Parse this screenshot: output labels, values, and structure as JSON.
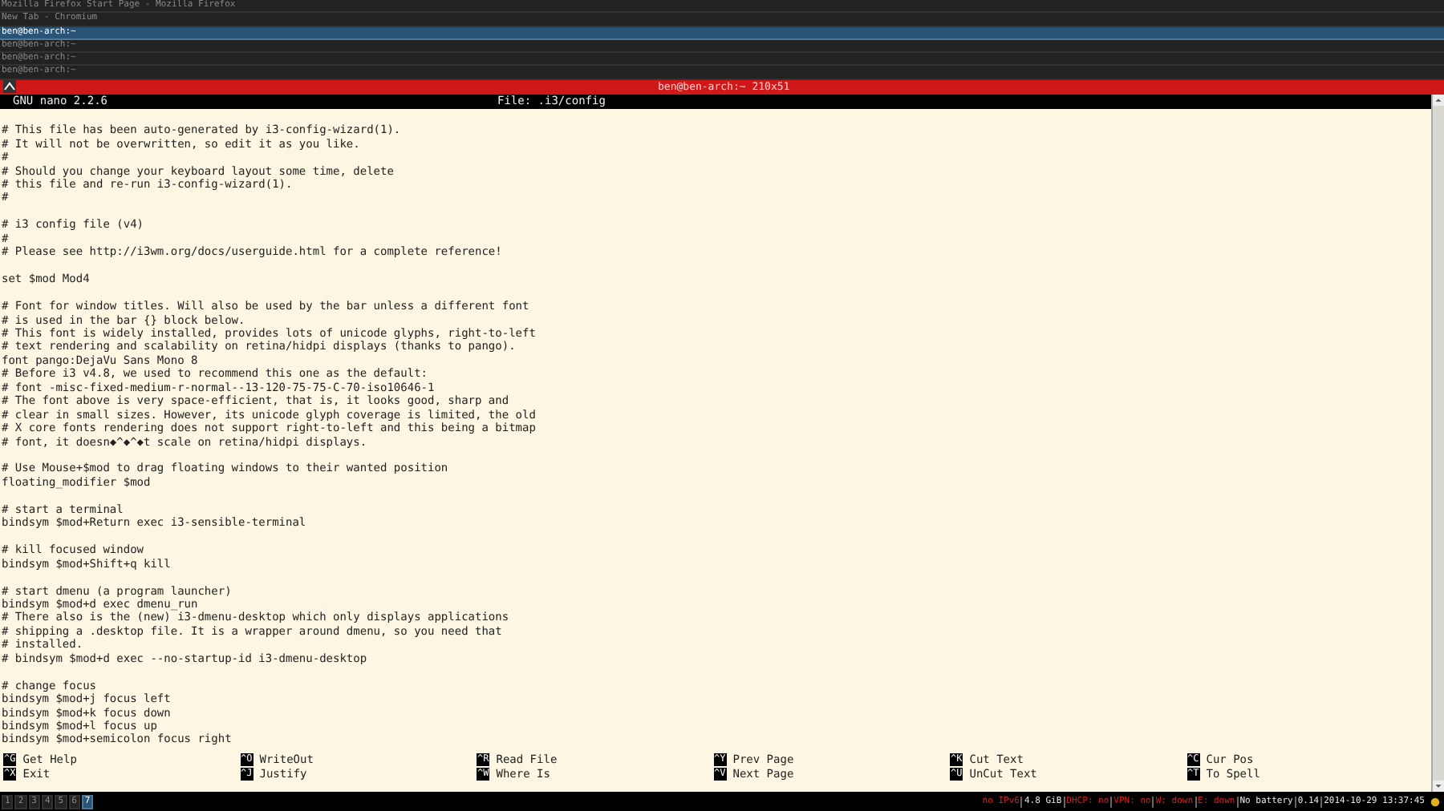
{
  "window_tabs": [
    {
      "title": "Mozilla Firefox Start Page - Mozilla Firefox",
      "selected": false
    },
    {
      "title": "New Tab - Chromium",
      "selected": false
    },
    {
      "title": "ben@ben-arch:~",
      "selected": true
    },
    {
      "title": "ben@ben-arch:~",
      "selected": false
    },
    {
      "title": "ben@ben-arch:~",
      "selected": false
    },
    {
      "title": "ben@ben-arch:~",
      "selected": false
    }
  ],
  "terminal": {
    "title": "ben@ben-arch:~ 210x51"
  },
  "nano": {
    "version": "GNU nano 2.2.6",
    "file": "File: .i3/config"
  },
  "lines": [
    {
      "kind": "blank"
    },
    {
      "kind": "text",
      "text": "# This file has been auto-generated by i3-config-wizard(1)."
    },
    {
      "kind": "text",
      "text": "# It will not be overwritten, so edit it as you like."
    },
    {
      "kind": "text",
      "text": "#"
    },
    {
      "kind": "text",
      "text": "# Should you change your keyboard layout some time, delete"
    },
    {
      "kind": "text",
      "text": "# this file and re-run i3-config-wizard(1)."
    },
    {
      "kind": "text",
      "text": "#"
    },
    {
      "kind": "blank"
    },
    {
      "kind": "text",
      "text": "# i3 config file (v4)"
    },
    {
      "kind": "text",
      "text": "#"
    },
    {
      "kind": "text",
      "text": "# Please see http://i3wm.org/docs/userguide.html for a complete reference!"
    },
    {
      "kind": "blank"
    },
    {
      "kind": "text",
      "text": "set $mod Mod4"
    },
    {
      "kind": "blank"
    },
    {
      "kind": "text",
      "text": "# Font for window titles. Will also be used by the bar unless a different font"
    },
    {
      "kind": "text",
      "text": "# is used in the bar {} block below."
    },
    {
      "kind": "text",
      "text": "# This font is widely installed, provides lots of unicode glyphs, right-to-left"
    },
    {
      "kind": "text",
      "text": "# text rendering and scalability on retina/hidpi displays (thanks to pango)."
    },
    {
      "kind": "text",
      "text": "font pango:DejaVu Sans Mono 8"
    },
    {
      "kind": "text",
      "text": "# Before i3 v4.8, we used to recommend this one as the default:"
    },
    {
      "kind": "text",
      "text": "# font -misc-fixed-medium-r-normal--13-120-75-75-C-70-iso10646-1"
    },
    {
      "kind": "text",
      "text": "# The font above is very space-efficient, that is, it looks good, sharp and"
    },
    {
      "kind": "text",
      "text": "# clear in small sizes. However, its unicode glyph coverage is limited, the old"
    },
    {
      "kind": "text",
      "text": "# X core fonts rendering does not support right-to-left and this being a bitmap"
    },
    {
      "kind": "text",
      "text": "# font, it doesn◆^◆^◆t scale on retina/hidpi displays."
    },
    {
      "kind": "blank"
    },
    {
      "kind": "text",
      "text": "# Use Mouse+$mod to drag floating windows to their wanted position"
    },
    {
      "kind": "text",
      "text": "floating_modifier $mod"
    },
    {
      "kind": "blank"
    },
    {
      "kind": "text",
      "text": "# start a terminal"
    },
    {
      "kind": "text",
      "text": "bindsym $mod+Return exec i3-sensible-terminal"
    },
    {
      "kind": "blank"
    },
    {
      "kind": "text",
      "text": "# kill focused window"
    },
    {
      "kind": "text",
      "text": "bindsym $mod+Shift+q kill"
    },
    {
      "kind": "blank"
    },
    {
      "kind": "text",
      "text": "# start dmenu (a program launcher)"
    },
    {
      "kind": "text",
      "text": "bindsym $mod+d exec dmenu_run"
    },
    {
      "kind": "text",
      "text": "# There also is the (new) i3-dmenu-desktop which only displays applications"
    },
    {
      "kind": "text",
      "text": "# shipping a .desktop file. It is a wrapper around dmenu, so you need that"
    },
    {
      "kind": "text",
      "text": "# installed."
    },
    {
      "kind": "text",
      "text": "# bindsym $mod+d exec --no-startup-id i3-dmenu-desktop"
    },
    {
      "kind": "blank"
    },
    {
      "kind": "text",
      "text": "# change focus"
    },
    {
      "kind": "text",
      "text": "bindsym $mod+j focus left"
    },
    {
      "kind": "text",
      "text": "bindsym $mod+k focus down"
    },
    {
      "kind": "text",
      "text": "bindsym $mod+l focus up"
    },
    {
      "kind": "text",
      "text": "bindsym $mod+semicolon focus right"
    }
  ],
  "shortcuts": [
    [
      {
        "key": "^G",
        "label": "Get Help"
      },
      {
        "key": "^X",
        "label": "Exit"
      }
    ],
    [
      {
        "key": "^O",
        "label": "WriteOut"
      },
      {
        "key": "^J",
        "label": "Justify"
      }
    ],
    [
      {
        "key": "^R",
        "label": "Read File"
      },
      {
        "key": "^W",
        "label": "Where Is"
      }
    ],
    [
      {
        "key": "^Y",
        "label": "Prev Page"
      },
      {
        "key": "^V",
        "label": "Next Page"
      }
    ],
    [
      {
        "key": "^K",
        "label": "Cut Text"
      },
      {
        "key": "^U",
        "label": "UnCut Text"
      }
    ],
    [
      {
        "key": "^C",
        "label": "Cur Pos"
      },
      {
        "key": "^T",
        "label": "To Spell"
      }
    ]
  ],
  "workspaces": [
    {
      "label": "1",
      "selected": false
    },
    {
      "label": "2",
      "selected": false
    },
    {
      "label": "3",
      "selected": false
    },
    {
      "label": "4",
      "selected": false
    },
    {
      "label": "5",
      "selected": false
    },
    {
      "label": "6",
      "selected": false
    },
    {
      "label": "7",
      "selected": true
    }
  ],
  "status": [
    {
      "text": "no IPv6",
      "kind": "bad"
    },
    {
      "text": "4.8 GiB",
      "kind": "ok"
    },
    {
      "text": "DHCP: no",
      "kind": "bad"
    },
    {
      "text": "VPN: no",
      "kind": "bad"
    },
    {
      "text": "W: down",
      "kind": "bad"
    },
    {
      "text": "E: down",
      "kind": "bad"
    },
    {
      "text": "No battery",
      "kind": "ok"
    },
    {
      "text": "0.14",
      "kind": "ok"
    },
    {
      "text": "2014-10-29 13:37:45",
      "kind": "ok"
    }
  ]
}
